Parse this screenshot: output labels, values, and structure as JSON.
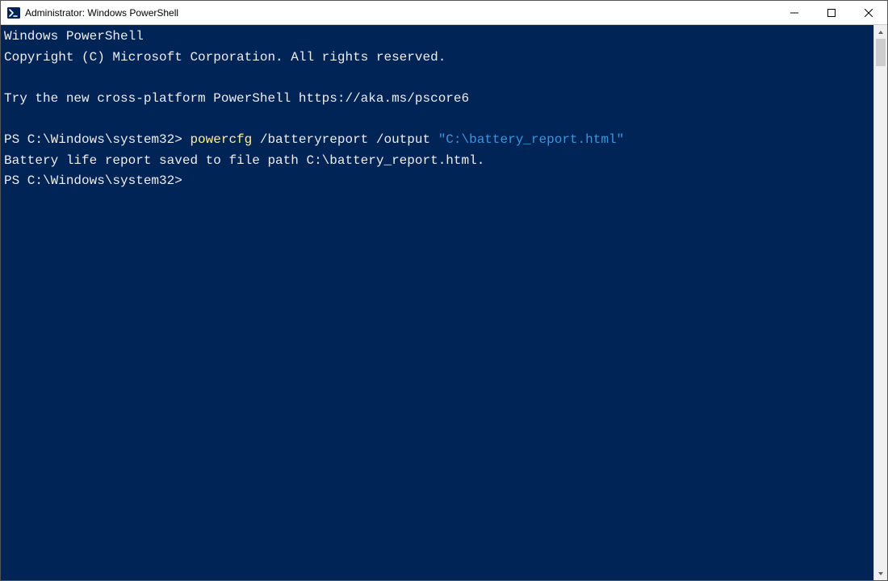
{
  "window": {
    "title": "Administrator: Windows PowerShell"
  },
  "terminal": {
    "banner_line1": "Windows PowerShell",
    "banner_line2": "Copyright (C) Microsoft Corporation. All rights reserved.",
    "hint_line": "Try the new cross-platform PowerShell https://aka.ms/pscore6",
    "prompt1_prefix": "PS C:\\Windows\\system32> ",
    "prompt1_cmd": "powercfg",
    "prompt1_args": " /batteryreport /output ",
    "prompt1_string": "\"C:\\battery_report.html\"",
    "output_line": "Battery life report saved to file path C:\\battery_report.html.",
    "prompt2_prefix": "PS C:\\Windows\\system32>"
  }
}
